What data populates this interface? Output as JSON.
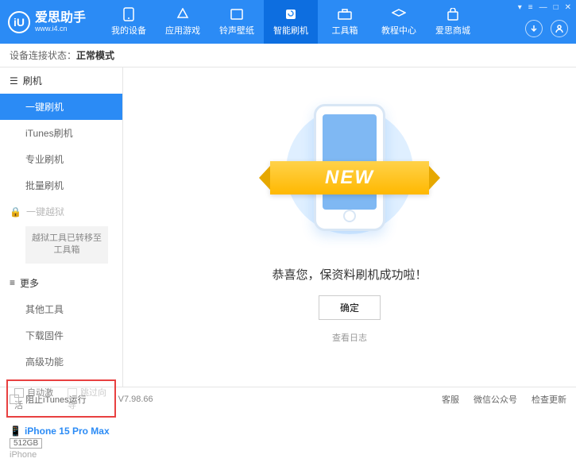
{
  "app": {
    "title": "爱思助手",
    "subtitle": "www.i4.cn",
    "logo_letter": "iU"
  },
  "nav": {
    "items": [
      {
        "label": "我的设备"
      },
      {
        "label": "应用游戏"
      },
      {
        "label": "铃声壁纸"
      },
      {
        "label": "智能刷机"
      },
      {
        "label": "工具箱"
      },
      {
        "label": "教程中心"
      },
      {
        "label": "爱思商城"
      }
    ],
    "active_index": 3
  },
  "status": {
    "prefix": "设备连接状态：",
    "value": "正常模式"
  },
  "sidebar": {
    "group1": {
      "header": "刷机",
      "items": [
        "一键刷机",
        "iTunes刷机",
        "专业刷机",
        "批量刷机"
      ],
      "active_index": 0
    },
    "group2": {
      "header": "一键越狱",
      "box_text": "越狱工具已转移至工具箱"
    },
    "group3": {
      "header": "更多",
      "items": [
        "其他工具",
        "下载固件",
        "高级功能"
      ]
    },
    "checkboxes": {
      "auto_activate": "自动激活",
      "skip_guide": "跳过向导"
    },
    "device": {
      "name": "iPhone 15 Pro Max",
      "storage": "512GB",
      "type": "iPhone"
    }
  },
  "main": {
    "ribbon": "NEW",
    "success_msg": "恭喜您，保资料刷机成功啦！",
    "ok_btn": "确定",
    "log_link": "查看日志"
  },
  "footer": {
    "block_itunes": "阻止iTunes运行",
    "version": "V7.98.66",
    "links": [
      "客服",
      "微信公众号",
      "检查更新"
    ]
  }
}
